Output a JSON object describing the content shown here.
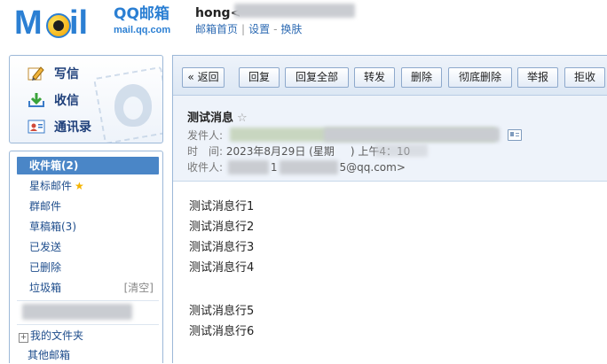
{
  "header": {
    "logo_text": "MOil",
    "brand_name": "QQ邮箱",
    "brand_domain": "mail.qq.com",
    "user_name": "hong<",
    "links": [
      "邮箱首页",
      "设置",
      "换肤"
    ],
    "link_separators": [
      "|",
      "-"
    ]
  },
  "sidebar": {
    "actions": [
      {
        "label": "写信",
        "icon": "pencil-icon"
      },
      {
        "label": "收信",
        "icon": "inbox-download-icon"
      },
      {
        "label": "通讯录",
        "icon": "contact-card-icon"
      }
    ],
    "folders": [
      {
        "label": "收件箱(2)",
        "active": true
      },
      {
        "label": "星标邮件",
        "star": "★"
      },
      {
        "label": "群邮件"
      },
      {
        "label": "草稿箱(3)"
      },
      {
        "label": "已发送"
      },
      {
        "label": "已删除"
      },
      {
        "label": "垃圾箱",
        "action": "[清空]"
      }
    ],
    "my_folders": "我的文件夹",
    "my_folders_toggle": "+",
    "other_mailboxes": "其他邮箱"
  },
  "toolbar": {
    "back": "« 返回",
    "reply": "回复",
    "reply_all": "回复全部",
    "forward": "转发",
    "delete": "删除",
    "delete_permanent": "彻底删除",
    "report": "举报",
    "reject": "拒收"
  },
  "message": {
    "subject": "测试消息",
    "star": "☆",
    "from_label": "发件人:",
    "time_label": "时　间:",
    "time_value_a": "2023年8月29日 (星期",
    "time_value_b": ") 上午4：10",
    "to_label": "收件人:",
    "to_value_a": "1",
    "to_value_b": "5@qq.com>",
    "body_lines": [
      "测试消息行1",
      "测试消息行2",
      "测试消息行3",
      "测试消息行4",
      "",
      "测试消息行5",
      "测试消息行6"
    ]
  },
  "colors": {
    "brand_blue": "#2b7fd3",
    "active_folder": "#4a86c7",
    "link_blue": "#2e6bb3",
    "panel_bg": "#eef3fa"
  }
}
